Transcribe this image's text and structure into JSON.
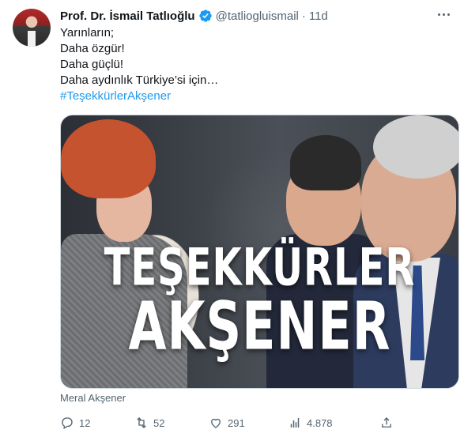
{
  "tweet": {
    "author_name": "Prof. Dr. İsmail Tatlıoğlu",
    "handle": "@tatliogluismail",
    "separator": "·",
    "time": "11d",
    "lines": [
      "Yarınların;",
      "Daha özgür!",
      "Daha güçlü!",
      "Daha aydınlık Türkiye’si için…"
    ],
    "hashtag": "#TeşekkürlerAkşener",
    "media": {
      "overlay_line1": "TEŞEKKÜRLER",
      "overlay_line2": "AKŞENER"
    },
    "media_caption": "Meral Akşener",
    "counts": {
      "replies": "12",
      "retweets": "52",
      "likes": "291",
      "views": "4.878"
    }
  },
  "colors": {
    "accent": "#1d9bf0",
    "text": "#0f1419",
    "muted": "#536471",
    "border": "#cfd9de"
  },
  "icons": [
    "verified-badge-icon",
    "more-icon",
    "reply-icon",
    "retweet-icon",
    "like-icon",
    "views-icon",
    "share-icon"
  ]
}
